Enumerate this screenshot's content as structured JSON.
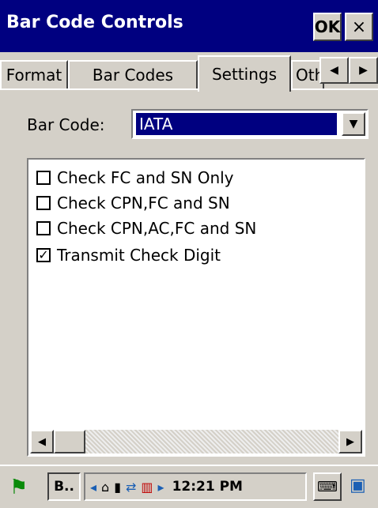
{
  "window": {
    "title": "Bar Code Controls",
    "ok_label": "OK",
    "close_label": "×"
  },
  "tabs": [
    {
      "label": "Format",
      "active": false
    },
    {
      "label": "Bar Codes",
      "active": false
    },
    {
      "label": "Settings",
      "active": true
    },
    {
      "label": "Oth",
      "active": false
    }
  ],
  "barcode": {
    "label": "Bar Code:",
    "value": "IATA"
  },
  "options": [
    {
      "label": "Check FC and SN Only",
      "checked": false
    },
    {
      "label": "Check CPN,FC and SN",
      "checked": false
    },
    {
      "label": "Check CPN,AC,FC and SN",
      "checked": false
    },
    {
      "label": "Transmit Check Digit",
      "checked": true
    }
  ],
  "taskbar": {
    "task_label": "B..",
    "clock": "12:21 PM"
  },
  "colors": {
    "titlebar": "#000080",
    "face": "#d4d0c8",
    "selection": "#000080"
  }
}
